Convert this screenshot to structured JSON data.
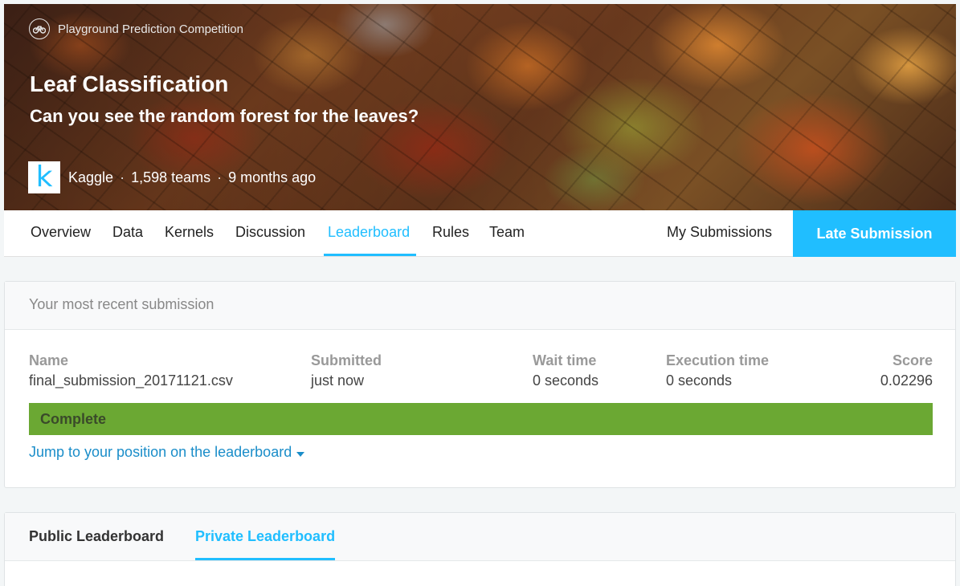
{
  "hero": {
    "competition_type": "Playground Prediction Competition",
    "title": "Leaf Classification",
    "subtitle": "Can you see the random forest for the leaves?",
    "host_logo_letter": "k",
    "host": "Kaggle",
    "teams": "1,598 teams",
    "time_ago": "9 months ago",
    "separator": "·"
  },
  "nav": {
    "tabs": [
      {
        "label": "Overview"
      },
      {
        "label": "Data"
      },
      {
        "label": "Kernels"
      },
      {
        "label": "Discussion"
      },
      {
        "label": "Leaderboard",
        "active": true
      },
      {
        "label": "Rules"
      },
      {
        "label": "Team"
      }
    ],
    "my_submissions": "My Submissions",
    "late_submission": "Late Submission"
  },
  "submission": {
    "header": "Your most recent submission",
    "columns": {
      "name": "Name",
      "submitted": "Submitted",
      "wait_time": "Wait time",
      "execution_time": "Execution time",
      "score": "Score"
    },
    "values": {
      "name": "final_submission_20171121.csv",
      "submitted": "just now",
      "wait_time": "0 seconds",
      "execution_time": "0 seconds",
      "score": "0.02296"
    },
    "status": "Complete",
    "jump_link": "Jump to your position on the leaderboard"
  },
  "leaderboard": {
    "tabs": [
      {
        "label": "Public Leaderboard"
      },
      {
        "label": "Private Leaderboard",
        "active": true
      }
    ]
  },
  "colors": {
    "accent": "#20beff",
    "status_complete": "#6ba833",
    "link": "#1a8dc9"
  },
  "icons": {
    "competition_type": "bicycle-icon",
    "jump_caret": "caret-down-icon"
  }
}
